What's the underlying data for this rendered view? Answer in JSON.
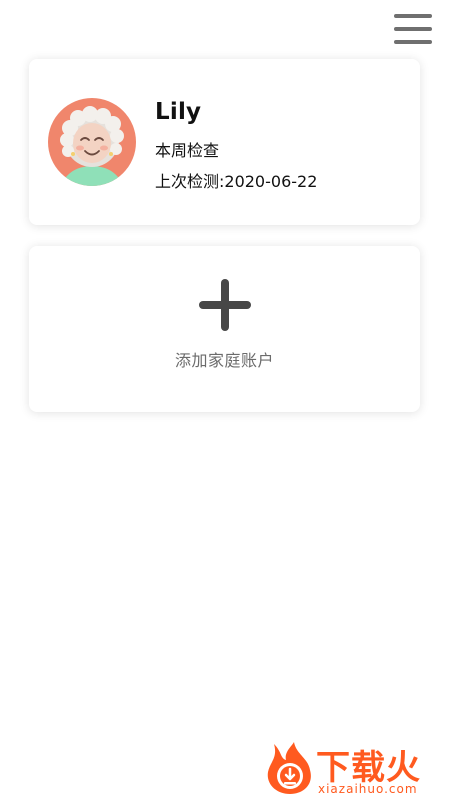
{
  "header": {
    "menu_icon": "hamburger-menu-icon"
  },
  "profile": {
    "name": "Lily",
    "status": "本周检查",
    "last_check": "上次检测:2020-06-22",
    "avatar_icon": "elderly-woman-avatar",
    "avatar_bg": "#f0866c"
  },
  "add_account": {
    "icon": "plus-icon",
    "label": "添加家庭账户"
  },
  "watermark": {
    "title": "下载火",
    "subtitle": "xiazaihuo.com",
    "color": "#ff5a1f"
  }
}
